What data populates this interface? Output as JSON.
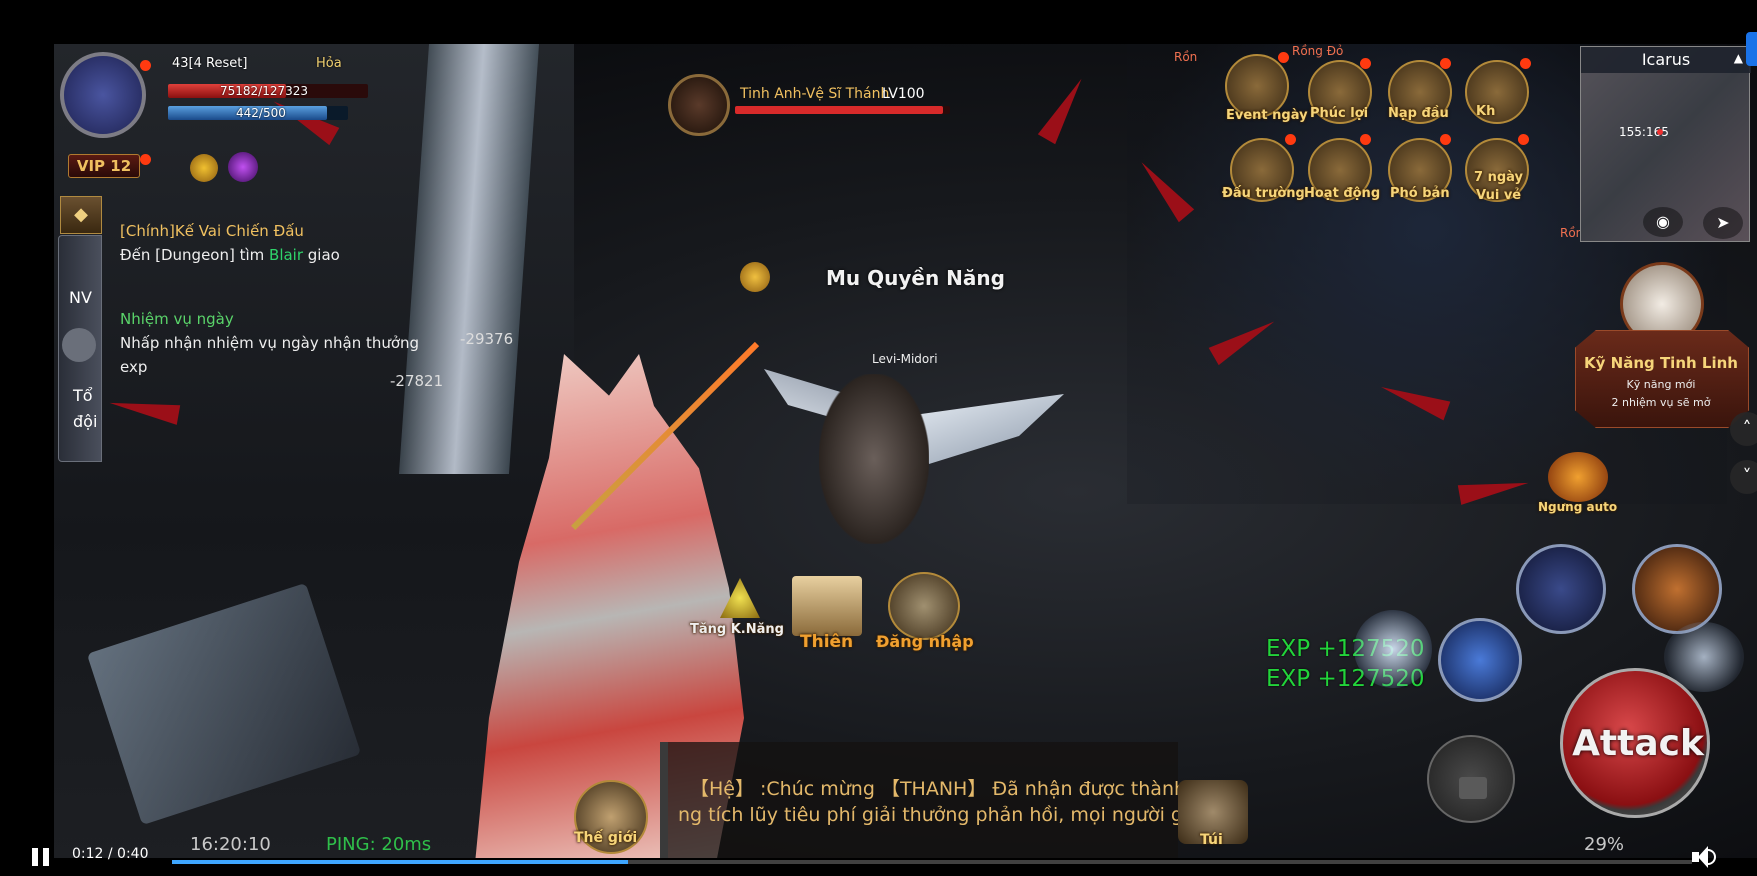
{
  "player": {
    "level_line": "43[4 Reset]",
    "element": "Hỏa",
    "hp": "75182/127323",
    "mp": "442/500",
    "vip": "VIP 12"
  },
  "quests": {
    "main_title": "[Chính]Kế Vai Chiến Đấu",
    "main_body_prefix": "Đến [Dungeon] tìm ",
    "main_body_npc": "Blair",
    "main_body_suffix": " giao",
    "daily_title": "Nhiệm vụ ngày",
    "daily_body_1": "Nhấp nhận nhiệm vụ ngày nhận thưởng",
    "daily_body_2": "exp"
  },
  "sidetabs": {
    "tab1": "NV",
    "tab2_line1": "Tổ",
    "tab2_line2": "đội"
  },
  "damage": {
    "d1": "-29376",
    "d2": "-27821"
  },
  "target": {
    "name": "Tinh Anh-Vệ Sĩ Thánh",
    "level": "LV100"
  },
  "guild_banner": "Mu Quyền Năng",
  "enemy_name": "Levi-Midori",
  "top_icons": [
    {
      "label": "Event ngày"
    },
    {
      "label": "Phúc lợi"
    },
    {
      "label": "Nạp đầu"
    },
    {
      "label": "Kh"
    },
    {
      "label": "Đấu trường"
    },
    {
      "label": "Hoạt động"
    },
    {
      "label": "Phó bản"
    },
    {
      "label": "7 ngày",
      "sublabel": "Vui vẻ"
    }
  ],
  "world_labels": {
    "rong_do": "Rồng Đỏ",
    "rong_left": "Rồn",
    "rong_right": "Rồn"
  },
  "minimap": {
    "title": "Icarus",
    "coords": "155:165"
  },
  "spirit_skill": {
    "title": "Kỹ Năng Tinh Linh",
    "line1": "Kỹ năng mới",
    "line2": "2 nhiệm vụ sẽ mở"
  },
  "auto_label": "Ngưng auto",
  "bottom_icons": {
    "skill_up": "Tăng K.Năng",
    "book": "Thiên",
    "login": "Đăng nhập",
    "world": "Thế giới",
    "bag": "Túi"
  },
  "exp_gains": [
    "EXP +127520",
    "EXP +127520"
  ],
  "attack_label": "Attack",
  "chat": {
    "line1": "【Hệ】 :Chúc mừng 【THANH】 Đã nhận được thành cô",
    "line2": "ng tích lũy tiêu phí giải thưởng phản hồi, mọi người ghen tị!"
  },
  "status": {
    "clock": "16:20:10",
    "ping": "PING: 20ms",
    "battery": "29%"
  },
  "video": {
    "time": "0:12 / 0:40",
    "progress": 0.3
  },
  "colors": {
    "exp": "#22d43a",
    "npc_highlight": "#2fd46a",
    "quest_title": "#f0c060",
    "daily_title": "#5ad46a",
    "progress": "#3ea6ff"
  }
}
